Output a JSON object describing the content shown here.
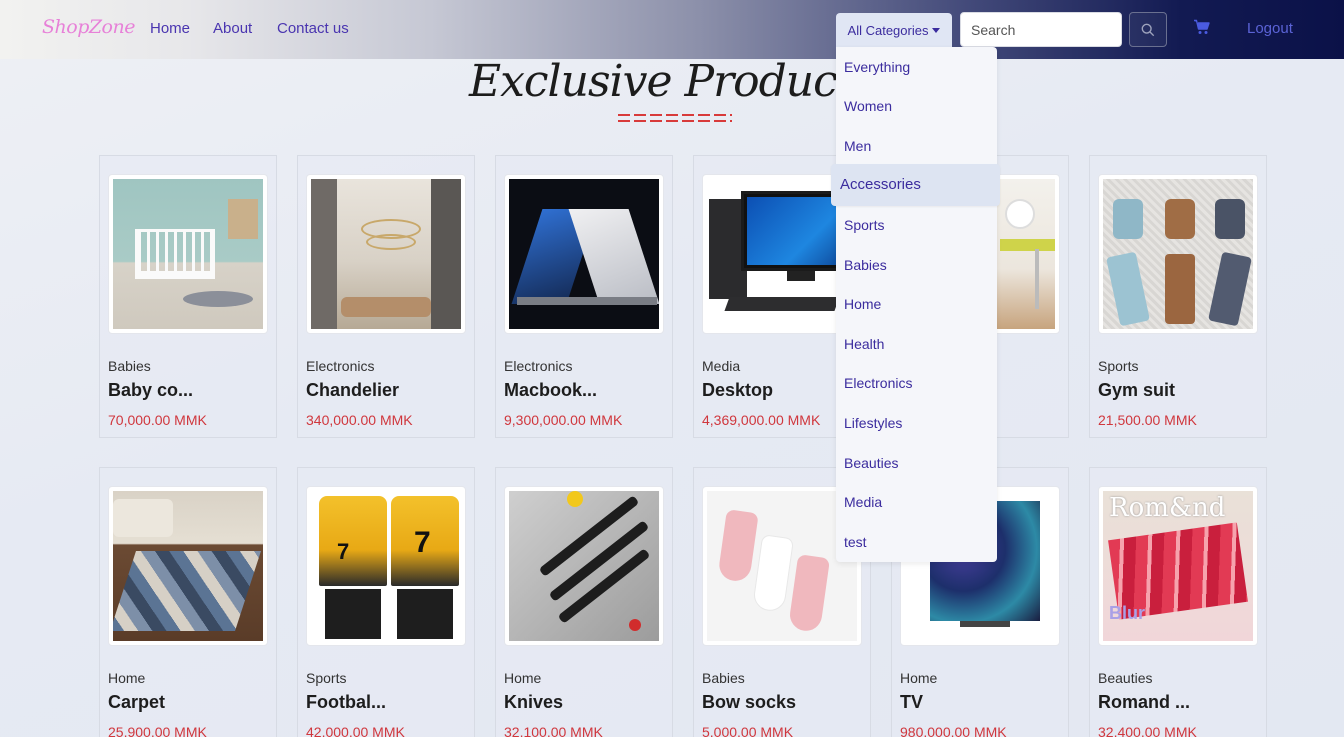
{
  "navbar": {
    "brand": "ShopZone",
    "links": [
      "Home",
      "About",
      "Contact us"
    ],
    "category_button": "All Categories",
    "search_placeholder": "Search",
    "logout": "Logout"
  },
  "page_title": "Exclusive Products",
  "categories_dropdown": {
    "items": [
      "Everything",
      "Women",
      "Men",
      "Accessories",
      "Sports",
      "Babies",
      "Home",
      "Health",
      "Electronics",
      "Lifestyles",
      "Beauties",
      "Media",
      "test"
    ],
    "highlighted": "Accessories"
  },
  "products": [
    {
      "category": "Babies",
      "name": "Baby co...",
      "price": "70,000.00 MMK"
    },
    {
      "category": "Electronics",
      "name": "Chandelier",
      "price": "340,000.00 MMK"
    },
    {
      "category": "Electronics",
      "name": "Macbook...",
      "price": "9,300,000.00 MMK"
    },
    {
      "category": "Media",
      "name": "Desktop",
      "price": "4,369,000.00 MMK"
    },
    {
      "category": "",
      "name": "",
      "price": "K"
    },
    {
      "category": "Sports",
      "name": "Gym suit",
      "price": "21,500.00 MMK"
    },
    {
      "category": "Home",
      "name": "Carpet",
      "price": "25,900.00 MMK"
    },
    {
      "category": "Sports",
      "name": "Footbal...",
      "price": "42,000.00 MMK"
    },
    {
      "category": "Home",
      "name": "Knives",
      "price": "32,100.00 MMK"
    },
    {
      "category": "Babies",
      "name": "Bow socks",
      "price": "5,000.00 MMK"
    },
    {
      "category": "Home",
      "name": "TV",
      "price": "980,000.00 MMK"
    },
    {
      "category": "Beauties",
      "name": "Romand ...",
      "price": "32,400.00 MMK"
    }
  ],
  "colors": {
    "accent": "#3b2c9e",
    "price": "#d0373d",
    "brand": "#e781d8"
  }
}
